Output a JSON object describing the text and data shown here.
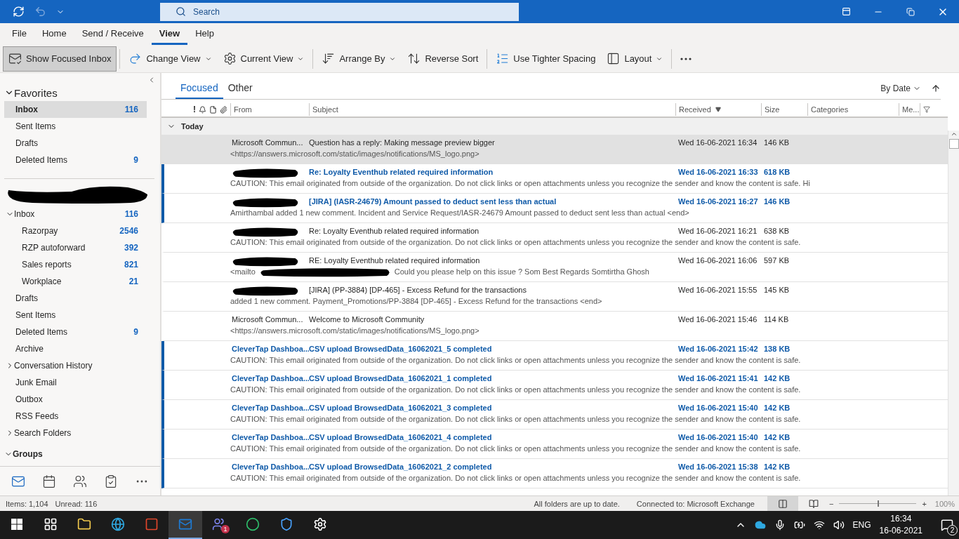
{
  "title_bar": {
    "search_placeholder": "Search"
  },
  "menu_tabs": [
    {
      "label": "File",
      "selected": false
    },
    {
      "label": "Home",
      "selected": false
    },
    {
      "label": "Send / Receive",
      "selected": false
    },
    {
      "label": "View",
      "selected": true
    },
    {
      "label": "Help",
      "selected": false
    }
  ],
  "ribbon": [
    {
      "label": "Show Focused Inbox",
      "pressed": true,
      "dropdown": false
    },
    {
      "label": "Change View",
      "pressed": false,
      "dropdown": true
    },
    {
      "label": "Current View",
      "pressed": false,
      "dropdown": true
    },
    {
      "label": "Arrange By",
      "pressed": false,
      "dropdown": true
    },
    {
      "label": "Reverse Sort",
      "pressed": false,
      "dropdown": false
    },
    {
      "label": "Use Tighter Spacing",
      "pressed": false,
      "dropdown": false
    },
    {
      "label": "Layout",
      "pressed": false,
      "dropdown": true
    }
  ],
  "sidebar": {
    "favorites": {
      "label": "Favorites",
      "expanded": true,
      "items": [
        {
          "label": "Inbox",
          "count": "116",
          "selected": true
        },
        {
          "label": "Sent Items",
          "selected": false
        },
        {
          "label": "Drafts",
          "selected": false
        },
        {
          "label": "Deleted Items",
          "count": "9",
          "selected": false
        }
      ]
    },
    "folders": [
      {
        "label": "Inbox",
        "count": "116",
        "expanded": true,
        "children": [
          {
            "label": "Razorpay",
            "count": "2546"
          },
          {
            "label": "RZP autoforward",
            "count": "392"
          },
          {
            "label": "Sales reports",
            "count": "821"
          },
          {
            "label": "Workplace",
            "count": "21"
          }
        ]
      },
      {
        "label": "Drafts"
      },
      {
        "label": "Sent Items"
      },
      {
        "label": "Deleted Items",
        "count": "9"
      },
      {
        "label": "Archive"
      },
      {
        "label": "Conversation History",
        "expanded": false
      },
      {
        "label": "Junk Email"
      },
      {
        "label": "Outbox"
      },
      {
        "label": "RSS Feeds"
      },
      {
        "label": "Search Folders",
        "expanded": false
      }
    ],
    "groups": {
      "label": "Groups",
      "expanded": true
    },
    "nav": [
      {
        "selected": true
      },
      {
        "selected": false
      },
      {
        "selected": false
      },
      {
        "selected": false
      },
      {
        "selected": false
      }
    ]
  },
  "focus_tabs": [
    {
      "label": "Focused",
      "selected": true
    },
    {
      "label": "Other",
      "selected": false
    }
  ],
  "sort": {
    "label": "By Date"
  },
  "columns": {
    "importance": "!",
    "from": "From",
    "subject": "Subject",
    "received": "Received",
    "size": "Size",
    "categories": "Categories",
    "mentions": "Me..."
  },
  "group": {
    "label": "Today",
    "expanded": true
  },
  "messages": [
    {
      "from": "Microsoft Commun...",
      "subject": "Question has a reply: Making message preview bigger",
      "received": "Wed 16-06-2021 16:34",
      "size": "146 KB",
      "preview": "<https://answers.microsoft.com/static/images/notifications/MS_logo.png>",
      "unread": false,
      "selected": true
    },
    {
      "from_redacted": true,
      "subject": "Re: Loyalty Eventhub related required information",
      "received": "Wed 16-06-2021 16:33",
      "size": "618 KB",
      "preview": "CAUTION: This email originated from outside of the organization. Do not click links or open attachments unless you recognize the sender and know the content is safe.   Hi",
      "unread": true,
      "selected": false
    },
    {
      "from_redacted": true,
      "subject": "[JIRA] (IASR-24679) Amount passed to deduct sent less than actual",
      "received": "Wed 16-06-2021 16:27",
      "size": "146 KB",
      "preview": "Amirthambal added 1 new comment. Incident and Service Request/IASR-24679 Amount passed to deduct sent less than actual <end>",
      "unread": true,
      "selected": false
    },
    {
      "from_redacted": true,
      "subject": "Re: Loyalty Eventhub related required information",
      "received": "Wed 16-06-2021 16:21",
      "size": "638 KB",
      "preview": "CAUTION: This email originated from outside of the organization. Do not click links or open attachments unless you recognize the sender and know the content is safe.",
      "unread": false,
      "selected": false
    },
    {
      "from_redacted": true,
      "subject": "RE: Loyalty Eventhub related required information",
      "received": "Wed 16-06-2021 16:06",
      "size": "597 KB",
      "preview": "<mailto",
      "preview_tail": "Could you please help on this issue ?  Som  Best Regards  Somtirtha Ghosh",
      "unread": false,
      "selected": false
    },
    {
      "from_redacted": true,
      "subject": "[JIRA] (PP-3884) [DP-465] - Excess Refund for the transactions",
      "received": "Wed 16-06-2021 15:55",
      "size": "145 KB",
      "preview": "added 1 new comment. Payment_Promotions/PP-3884 [DP-465] - Excess Refund for the transactions <end>",
      "unread": false,
      "selected": false
    },
    {
      "from": "Microsoft Commun...",
      "subject": "Welcome to Microsoft Community",
      "received": "Wed 16-06-2021 15:46",
      "size": "114 KB",
      "preview": "<https://answers.microsoft.com/static/images/notifications/MS_logo.png>",
      "unread": false,
      "selected": false
    },
    {
      "from": "CleverTap Dashboa...",
      "subject": "CSV upload BrowsedData_16062021_5 completed",
      "received": "Wed 16-06-2021 15:42",
      "size": "138 KB",
      "preview": "CAUTION: This email originated from outside of the organization. Do not click links or open attachments unless you recognize the sender and know the content is safe.",
      "unread": true,
      "selected": false
    },
    {
      "from": "CleverTap Dashboa...",
      "subject": "CSV upload BrowsedData_16062021_1 completed",
      "received": "Wed 16-06-2021 15:41",
      "size": "142 KB",
      "preview": "CAUTION: This email originated from outside of the organization. Do not click links or open attachments unless you recognize the sender and know the content is safe.",
      "unread": true,
      "selected": false
    },
    {
      "from": "CleverTap Dashboa...",
      "subject": "CSV upload BrowsedData_16062021_3 completed",
      "received": "Wed 16-06-2021 15:40",
      "size": "142 KB",
      "preview": "CAUTION: This email originated from outside of the organization. Do not click links or open attachments unless you recognize the sender and know the content is safe.",
      "unread": true,
      "selected": false
    },
    {
      "from": "CleverTap Dashboa...",
      "subject": "CSV upload BrowsedData_16062021_4 completed",
      "received": "Wed 16-06-2021 15:40",
      "size": "142 KB",
      "preview": "CAUTION: This email originated from outside of the organization. Do not click links or open attachments unless you recognize the sender and know the content is safe.",
      "unread": true,
      "selected": false
    },
    {
      "from": "CleverTap Dashboa...",
      "subject": "CSV upload BrowsedData_16062021_2 completed",
      "received": "Wed 16-06-2021 15:38",
      "size": "142 KB",
      "preview": "CAUTION: This email originated from outside of the organization. Do not click links or open attachments unless you recognize the sender and know the content is safe.",
      "unread": true,
      "selected": false
    }
  ],
  "status_bar": {
    "items": "Items: 1,104",
    "unread": "Unread: 116",
    "sync": "All folders are up to date.",
    "connection": "Connected to: Microsoft Exchange",
    "zoom": {
      "minus": "−",
      "plus": "+",
      "level": 0.5,
      "reading": "100%"
    }
  },
  "taskbar": {
    "apps": [
      {
        "selected": false
      },
      {
        "selected": false
      },
      {
        "selected": false
      },
      {
        "selected": false
      },
      {
        "selected": false
      },
      {
        "selected": true
      },
      {
        "selected": false,
        "badge": "1"
      },
      {
        "selected": false
      },
      {
        "selected": false
      },
      {
        "selected": false
      }
    ],
    "language": "ENG",
    "time": "16:34",
    "date": "16-06-2021",
    "notifications": "2"
  }
}
